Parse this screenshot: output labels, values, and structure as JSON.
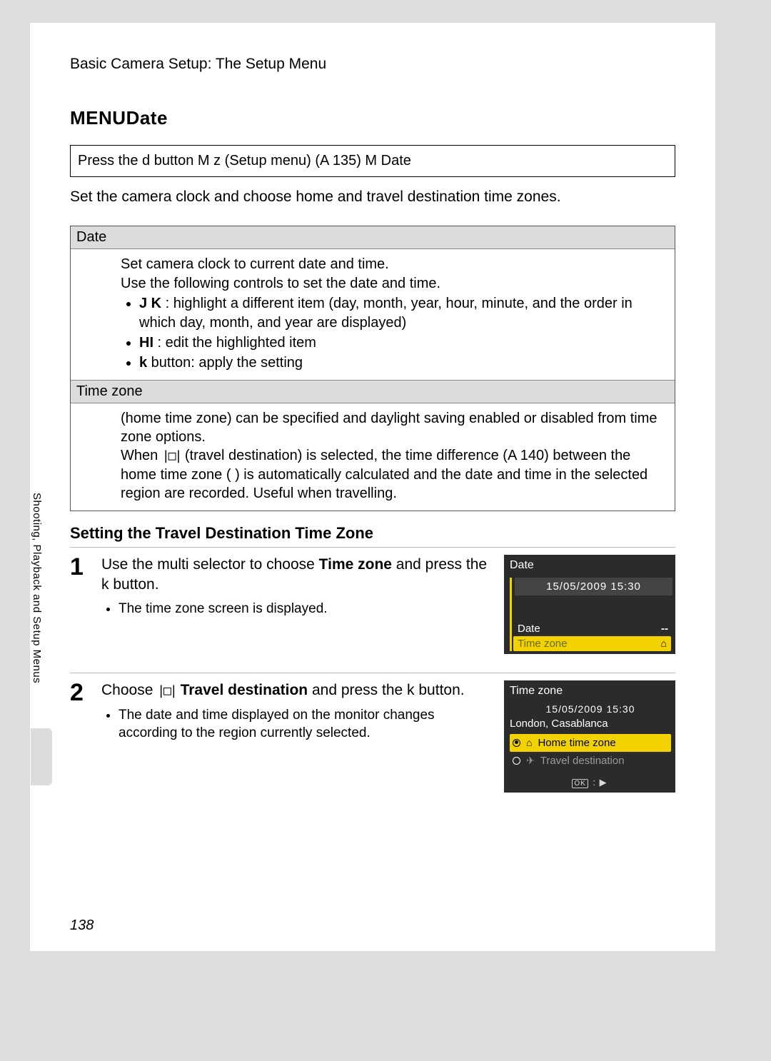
{
  "header": "Basic Camera Setup: The Setup Menu",
  "title_prefix": "MENU",
  "title": "Date",
  "nav_box": "Press the d     button M z  (Setup menu) (A   135) M  Date",
  "intro": "Set the camera clock and choose home and travel destination time zones.",
  "defs": {
    "date_head": "Date",
    "date_body_l1": "Set camera clock to current date and time.",
    "date_body_l2": "Use the following controls to set the date and time.",
    "date_b1a": "J  K",
    "date_b1b": " : highlight a different item (day, month, year, hour, minute, and the order in which day, month, and year are displayed)",
    "date_b2a": "HI",
    "date_b2b": "   : edit the highlighted item",
    "date_b3a": "k",
    "date_b3b": "  button: apply the setting",
    "tz_head": "Time zone",
    "tz_body_l1": "   (home time zone) can be specified and daylight saving enabled or disabled from time zone options.",
    "tz_body_l2a": "When ",
    "tz_body_l2b": " (travel destination) is selected, the time difference (A   140) between the home time zone (   ) is automatically calculated and the date and time in the selected region are recorded. Useful when travelling."
  },
  "subheading": "Setting the Travel Destination Time Zone",
  "steps": {
    "s1_main_a": "Use the multi selector to choose ",
    "s1_main_b": "Time zone",
    "s1_main_c": " and press the k   button.",
    "s1_bullet": "The time zone screen is displayed.",
    "s2_main_a": "Choose ",
    "s2_main_b": " Travel destination",
    "s2_main_c": " and press the k   button.",
    "s2_bullet": "The date and time displayed on the monitor changes according to the region currently selected."
  },
  "lcd1": {
    "title": "Date",
    "datetime": "15/05/2009  15:30",
    "row1": "Date",
    "row1v": "--",
    "row2": "Time zone"
  },
  "lcd2": {
    "title": "Time zone",
    "datetime": "15/05/2009  15:30",
    "location": "London, Casablanca",
    "opt1": "Home time zone",
    "opt2": "Travel destination",
    "footer_ok": "OK"
  },
  "side_label": "Shooting, Playback and Setup Menus",
  "page_number": "138"
}
